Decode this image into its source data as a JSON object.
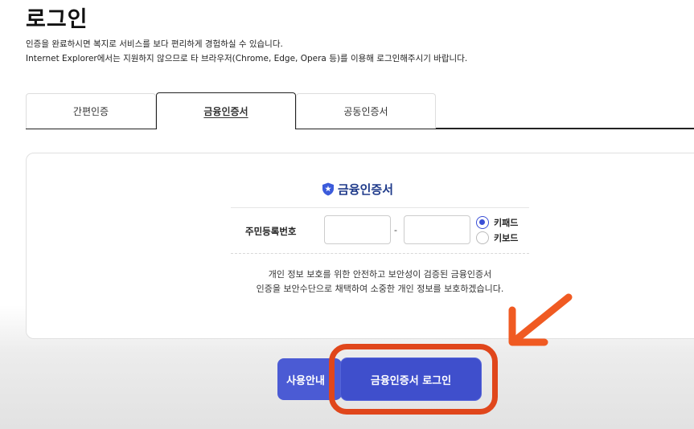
{
  "page": {
    "title": "로그인",
    "notice_line1": "인증을 완료하시면 복지로 서비스를 보다 편리하게 경험하실 수 있습니다.",
    "notice_line2": "Internet Explorer에서는 지원하지 않으므로 타 브라우저(Chrome, Edge, Opera 등)를 이용해 로그인해주시기 바랍니다."
  },
  "tabs": [
    {
      "label": "간편인증",
      "active": false
    },
    {
      "label": "금융인증서",
      "active": true
    },
    {
      "label": "공동인증서",
      "active": false
    }
  ],
  "panel": {
    "title": "금융인증서",
    "title_icon": "shield-icon",
    "rrn_label": "주민등록번호",
    "rrn_separator": "-",
    "rrn_first_value": "",
    "rrn_second_value": "",
    "input_mode_options": [
      {
        "label": "키패드",
        "selected": true
      },
      {
        "label": "키보드",
        "selected": false
      }
    ],
    "description_line1": "개인 정보 보호를 위한 안전하고 보안성이 검증된 금융인증서",
    "description_line2": "인증을 보안수단으로 채택하여 소중한 개인 정보를 보호하겠습니다."
  },
  "buttons": {
    "guide_label": "사용안내",
    "login_label": "금융인증서 로그인"
  },
  "colors": {
    "accent": "#3f4fcc",
    "highlight": "#e0461b",
    "title_blue": "#1e3a8a"
  }
}
